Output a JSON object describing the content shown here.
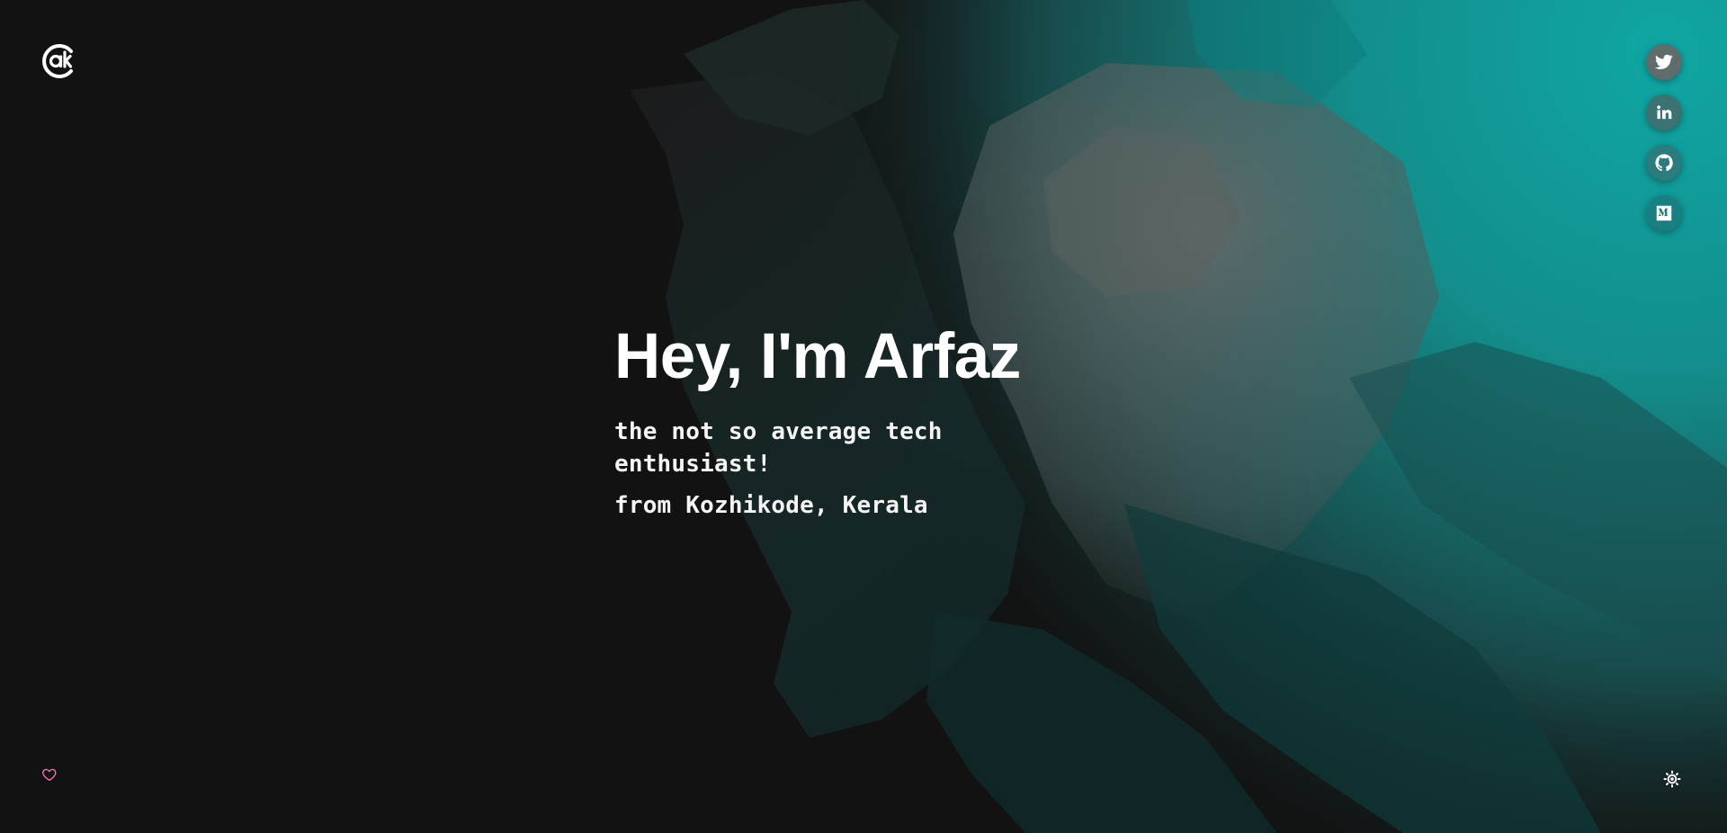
{
  "hero": {
    "heading": "Hey, I'm Arfaz",
    "tagline": "the not so average tech enthusiast!",
    "location": "from Kozhikode, Kerala"
  },
  "brand": {
    "logo_icon": "ak-logo-icon"
  },
  "socials": [
    {
      "name": "Twitter",
      "icon": "twitter-icon"
    },
    {
      "name": "LinkedIn",
      "icon": "linkedin-icon"
    },
    {
      "name": "GitHub",
      "icon": "github-icon"
    },
    {
      "name": "Medium",
      "icon": "medium-icon"
    }
  ],
  "footer": {
    "heart_icon": "heart-icon",
    "theme_icon": "sun-icon"
  },
  "colors": {
    "background": "#121212",
    "text": "#ffffff",
    "accent_teal": "#0e9a9a",
    "heart_pink": "#ff6fb5"
  }
}
